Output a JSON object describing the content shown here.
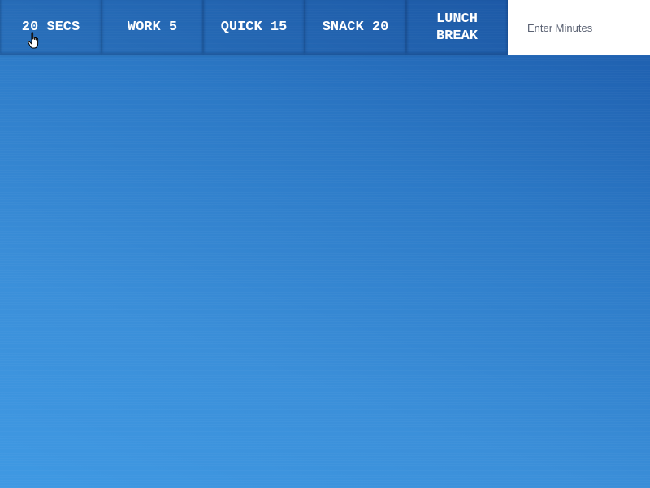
{
  "timer_buttons": [
    {
      "label": "20 SECS"
    },
    {
      "label": "WORK 5"
    },
    {
      "label": "QUICK 15"
    },
    {
      "label": "SNACK 20"
    },
    {
      "label": "LUNCH BREAK"
    }
  ],
  "custom_input": {
    "placeholder": "Enter Minutes"
  },
  "cursor": {
    "icon": "hand-pointer-icon"
  },
  "colors": {
    "button_text": "#ffffff",
    "input_background": "#ffffff",
    "background_top": "#1c5aaa",
    "background_bottom": "#3f99e3"
  }
}
